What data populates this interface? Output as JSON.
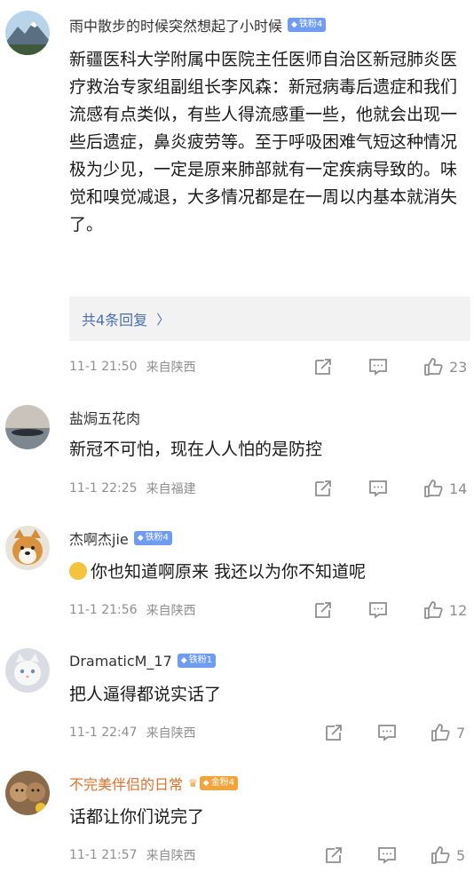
{
  "comments": [
    {
      "username": "雨中散步的时候突然想起了小时候",
      "badge": "铁粉4",
      "badge_type": "iron",
      "text": "新疆医科大学附属中医院主任医师自治区新冠肺炎医疗救治专家组副组长李风森：新冠病毒后遗症和我们流感有点类似，有些人得流感重一些，他就会出现一些后遗症，鼻炎疲劳等。至于呼吸困难气短这种情况极为少见，一定是原来肺部就有一定疾病导致的。味觉和嗅觉减退，大多情况都是在一周以内基本就消失了。",
      "replies_label": "共4条回复",
      "time": "11-1 21:50",
      "location": "来自陕西",
      "likes": "23",
      "avatar_icon": "mountain-landscape-avatar"
    },
    {
      "username": "盐焗五花肉",
      "text": "新冠不可怕，现在人人怕的是防控",
      "time": "11-1 22:25",
      "location": "来自福建",
      "likes": "14",
      "avatar_icon": "lake-sunset-avatar"
    },
    {
      "username": "杰啊杰jie",
      "badge": "铁粉4",
      "badge_type": "iron",
      "emoji": "surprised-face-emoji",
      "text": "你也知道啊原来 我还以为你不知道呢",
      "time": "11-1 21:56",
      "location": "来自陕西",
      "likes": "12",
      "avatar_icon": "shiba-dog-avatar"
    },
    {
      "username": "DramaticM_17",
      "badge": "铁粉1",
      "badge_type": "iron",
      "text": "把人逼得都说实话了",
      "time": "11-1 22:47",
      "location": "来自陕西",
      "likes": "7",
      "avatar_icon": "white-cat-avatar"
    },
    {
      "username": "不完美伴侣的日常",
      "badge": "金粉4",
      "badge_type": "gold",
      "text": "话都让你们说完了",
      "time": "11-1 21:57",
      "location": "来自陕西",
      "likes": "5",
      "avatar_icon": "cartoon-faces-avatar",
      "username_color": "#e2702a"
    }
  ],
  "icons": {
    "share": "share-icon",
    "comment": "comment-icon",
    "like": "thumbs-up-icon"
  },
  "colors": {
    "link_blue": "#4a6fb5",
    "badge_iron": "#6f9cf2",
    "badge_gold": "#f0a43a",
    "meta_gray": "#8f8f8f"
  }
}
